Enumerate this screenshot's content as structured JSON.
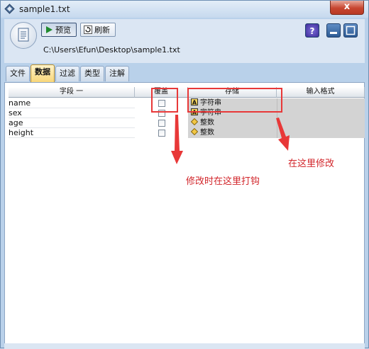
{
  "window": {
    "title": "sample1.txt",
    "close_label": "x"
  },
  "toolbar": {
    "preview_label": "预览",
    "refresh_label": "刷新"
  },
  "file_path": "C:\\Users\\Efun\\Desktop\\sample1.txt",
  "tabs": [
    {
      "label": "文件",
      "active": false
    },
    {
      "label": "数据",
      "active": true
    },
    {
      "label": "过滤",
      "active": false
    },
    {
      "label": "类型",
      "active": false
    },
    {
      "label": "注解",
      "active": false
    }
  ],
  "table": {
    "columns": [
      "字段 一",
      "覆盖",
      "存储",
      "输入格式"
    ],
    "rows": [
      {
        "field": "name",
        "storage": "字符串",
        "storage_icon": "string-type-icon"
      },
      {
        "field": "sex",
        "storage": "字符串",
        "storage_icon": "string-type-icon"
      },
      {
        "field": "age",
        "storage": "整数",
        "storage_icon": "integer-type-icon"
      },
      {
        "field": "height",
        "storage": "整数",
        "storage_icon": "integer-type-icon"
      }
    ]
  },
  "annotations": {
    "override_hint": "修改时在这里打钩",
    "storage_hint": "在这里修改"
  },
  "colors": {
    "annotation_red": "#e83838",
    "active_tab": "#f8d77a"
  }
}
